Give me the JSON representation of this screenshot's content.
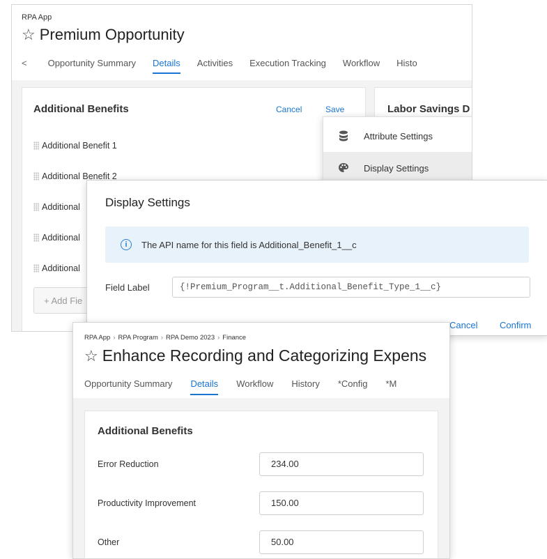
{
  "window1": {
    "app_label": "RPA App",
    "title": "Premium Opportunity",
    "tabs": [
      "Opportunity Summary",
      "Details",
      "Activities",
      "Execution Tracking",
      "Workflow",
      "Histo"
    ],
    "active_tab": "Details",
    "card_title": "Additional Benefits",
    "cancel_label": "Cancel",
    "save_label": "Save",
    "benefits": [
      "Additional Benefit 1",
      "Additional Benefit 2",
      "Additional",
      "Additional",
      "Additional"
    ],
    "add_field_label": "+ Add Fie",
    "side_card_title": "Labor Savings D",
    "menu": [
      {
        "label": "Attribute Settings",
        "icon": "database-icon"
      },
      {
        "label": "Display Settings",
        "icon": "palette-icon"
      }
    ]
  },
  "dialog": {
    "title": "Display Settings",
    "info_text": "The API name for this field is Additional_Benefit_1__c",
    "field_label": "Field Label",
    "field_value": "{!Premium_Program__t.Additional_Benefit_Type_1__c}",
    "cancel_label": "Cancel",
    "confirm_label": "Confirm"
  },
  "window3": {
    "breadcrumb": [
      "RPA App",
      "RPA Program",
      "RPA Demo 2023",
      "Finance"
    ],
    "title": "Enhance Recording and Categorizing Expens",
    "tabs": [
      "Opportunity Summary",
      "Details",
      "Workflow",
      "History",
      "*Config",
      "*M"
    ],
    "active_tab": "Details",
    "card_title": "Additional Benefits",
    "rows": [
      {
        "label": "Error Reduction",
        "value": "234.00"
      },
      {
        "label": "Productivity Improvement",
        "value": "150.00"
      },
      {
        "label": "Other",
        "value": "50.00"
      }
    ]
  },
  "colors": {
    "accent": "#1a74d1",
    "info_bg": "#e8f2fb"
  }
}
